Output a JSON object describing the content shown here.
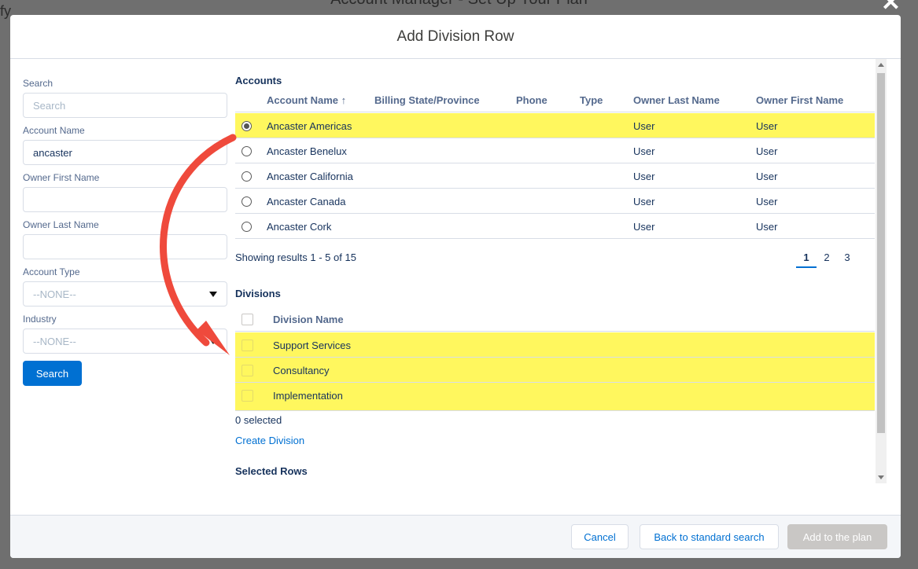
{
  "background": {
    "title": "Account Manager - Set Up Your Plan",
    "left_fragment": "fy",
    "close_glyph": "✕"
  },
  "modal": {
    "title": "Add Division Row"
  },
  "filters": {
    "search_label": "Search",
    "search_placeholder": "Search",
    "account_name_label": "Account Name",
    "account_name_value": "ancaster",
    "owner_first_label": "Owner First Name",
    "owner_first_value": "",
    "owner_last_label": "Owner Last Name",
    "owner_last_value": "",
    "account_type_label": "Account Type",
    "account_type_value": "--NONE--",
    "industry_label": "Industry",
    "industry_value": "--NONE--",
    "search_button": "Search"
  },
  "accounts": {
    "title": "Accounts",
    "columns": [
      "Account Name ↑",
      "Billing State/Province",
      "Phone",
      "Type",
      "Owner Last Name",
      "Owner First Name"
    ],
    "rows": [
      {
        "name": "Ancaster Americas",
        "state": "",
        "phone": "",
        "type": "",
        "owner_last": "User",
        "owner_first": "User",
        "selected": true
      },
      {
        "name": "Ancaster Benelux",
        "state": "",
        "phone": "",
        "type": "",
        "owner_last": "User",
        "owner_first": "User",
        "selected": false
      },
      {
        "name": "Ancaster California",
        "state": "",
        "phone": "",
        "type": "",
        "owner_last": "User",
        "owner_first": "User",
        "selected": false
      },
      {
        "name": "Ancaster Canada",
        "state": "",
        "phone": "",
        "type": "",
        "owner_last": "User",
        "owner_first": "User",
        "selected": false
      },
      {
        "name": "Ancaster Cork",
        "state": "",
        "phone": "",
        "type": "",
        "owner_last": "User",
        "owner_first": "User",
        "selected": false
      }
    ],
    "results_text": "Showing results 1 - 5 of 15",
    "pages": [
      "1",
      "2",
      "3"
    ],
    "current_page": "1"
  },
  "divisions": {
    "title": "Divisions",
    "column": "Division Name",
    "rows": [
      "Support Services",
      "Consultancy",
      "Implementation"
    ],
    "selected_text": "0 selected",
    "create_link": "Create Division"
  },
  "selected_rows": {
    "title": "Selected Rows"
  },
  "footer": {
    "cancel": "Cancel",
    "back": "Back to standard search",
    "add": "Add to the plan"
  },
  "colors": {
    "highlight": "#fff75e",
    "annotation_arrow": "#ef4a3c",
    "brand": "#0070d2"
  }
}
